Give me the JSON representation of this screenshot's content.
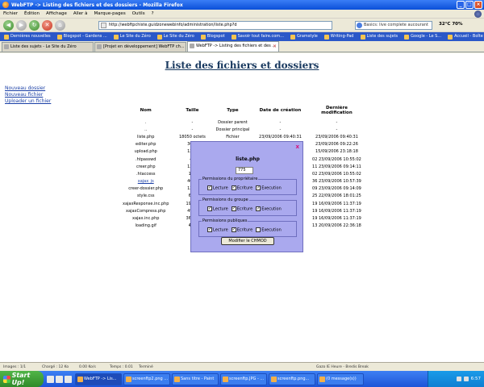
{
  "window": {
    "title": "WebFTP -> Listing des fichiers et des dossiers - Mozilla Firefox"
  },
  "menu": [
    "Fichier",
    "Édition",
    "Affichage",
    "Aller à",
    "Marque-pages",
    "Outils",
    "?"
  ],
  "navbar": {
    "url": "http://webftpchiste.guidzonewebinfo/administration/liste.php?d",
    "search_placeholder": "Basics: live complete aucourant",
    "weather": "32°C 70%"
  },
  "bookmarks": [
    "Dernières nouvelles",
    "Blogspot - Gardens ...",
    "Le Site du Zéro",
    "Le Site du Zéro",
    "Blogspot",
    "Savoir tout faire.com...",
    "Gramstyle",
    "Writing-Pad",
    "Liste des sujets",
    "Google - Le S...",
    "Accueil - Boîte de ..."
  ],
  "tabs": [
    {
      "label": "Liste des sujets - Le Site du Zéro",
      "active": false
    },
    {
      "label": "[Projet en développement] WebFTP ch...",
      "active": false
    },
    {
      "label": "WebFTP -> Listing des fichiers et des ...",
      "active": true
    }
  ],
  "page": {
    "title": "Liste des fichiers et dossiers",
    "links": [
      "Nouveau dossier",
      "Nouveau fichier",
      "Uploader un fichier"
    ],
    "columns": [
      "Nom",
      "Taille",
      "Type",
      "Date de création",
      "Dernière modification"
    ],
    "rows": [
      {
        "name": ".",
        "size": "-",
        "type": "Dossier parent",
        "created": "-",
        "modified": "-"
      },
      {
        "name": "..",
        "size": "-",
        "type": "Dossier principal",
        "created": "-",
        "modified": "-"
      },
      {
        "name": "liste.php",
        "size": "18050 octets",
        "type": "Fichier",
        "created": "23/09/2006 09:40:31",
        "modified": "23/09/2006 09:40:31"
      },
      {
        "name": "editer.php",
        "size": "3063",
        "type": "",
        "created": "",
        "modified": "23/09/2006 09:22:26"
      },
      {
        "name": "upload.php",
        "size": "1250",
        "type": "",
        "created": "",
        "modified": "15/09/2006 23:18:18"
      },
      {
        "name": ".htpasswd",
        "size": "43",
        "type": "",
        "created": "",
        "modified": "02   23/09/2006 10:55:02"
      },
      {
        "name": "creer.php",
        "size": "1210",
        "type": "",
        "created": "",
        "modified": "11   23/09/2006 09:14:11"
      },
      {
        "name": ".htaccess",
        "size": "172",
        "type": "",
        "created": "",
        "modified": "02   23/09/2006 10:55:02"
      },
      {
        "name": "xajax_js",
        "size": "4096",
        "type": "",
        "created": "",
        "modified": "36   23/09/2006 10:57:39"
      },
      {
        "name": "creer-dossier.php",
        "size": "1241",
        "type": "",
        "created": "",
        "modified": "09   23/09/2006 09:14:09"
      },
      {
        "name": "style.css",
        "size": "615",
        "type": "",
        "created": "",
        "modified": "25   22/09/2006 18:01:25"
      },
      {
        "name": "xajaxResponse.inc.php",
        "size": "19436",
        "type": "",
        "created": "",
        "modified": "19   16/09/2006 11:37:19"
      },
      {
        "name": "xajaxCompress.php",
        "size": "4974",
        "type": "",
        "created": "",
        "modified": "19   16/09/2006 11:37:19"
      },
      {
        "name": "xajax.inc.php",
        "size": "36477",
        "type": "",
        "created": "",
        "modified": "19   16/09/2006 11:37:19"
      },
      {
        "name": "loading.gif",
        "size": "418",
        "type": "",
        "created": "",
        "modified": "13   20/09/2006 22:36:18"
      }
    ]
  },
  "modal": {
    "close_label": "x",
    "file_name": "liste.php",
    "chmod_value": "775",
    "groups": [
      {
        "legend": "Permissions du propriétaire",
        "options": [
          {
            "label": "Lecture",
            "checked": true
          },
          {
            "label": "Ecriture",
            "checked": true
          },
          {
            "label": "Execution",
            "checked": true
          }
        ]
      },
      {
        "legend": "Permissions du groupe",
        "options": [
          {
            "label": "Lecture",
            "checked": true
          },
          {
            "label": "Ecriture",
            "checked": true
          },
          {
            "label": "Execution",
            "checked": true
          }
        ]
      },
      {
        "legend": "Permissions publiques",
        "options": [
          {
            "label": "Lecture",
            "checked": true
          },
          {
            "label": "Ecriture",
            "checked": true
          },
          {
            "label": "Execution",
            "checked": false
          }
        ]
      }
    ],
    "submit_label": "Modifier le CHMOD"
  },
  "statusbar": {
    "images": "Images : 1/1",
    "loaded": "Chargé : 12 Ko",
    "speed": "0.00 Ko/s",
    "time": "Temps : 0.01",
    "state": "Terminé",
    "right": "Gazo IE Heure - Bredis Break"
  },
  "taskbar": {
    "start_label": "Start Up!",
    "items": [
      {
        "label": "WebFTP -> Lis...",
        "active": true
      },
      {
        "label": "screenftp2.png ...",
        "active": false
      },
      {
        "label": "Sans titre - Paint",
        "active": false
      },
      {
        "label": "screenftp.JPG - ...",
        "active": false
      },
      {
        "label": "screenftp.png...",
        "active": false
      },
      {
        "label": "(0 message(s))",
        "active": false
      }
    ],
    "clock": "6:57"
  },
  "colors": {
    "modal_bg": "#aaa9ee",
    "page_title": "#1a3a60",
    "link": "#1a3fa6",
    "titlebar": "#0a4fd8"
  }
}
